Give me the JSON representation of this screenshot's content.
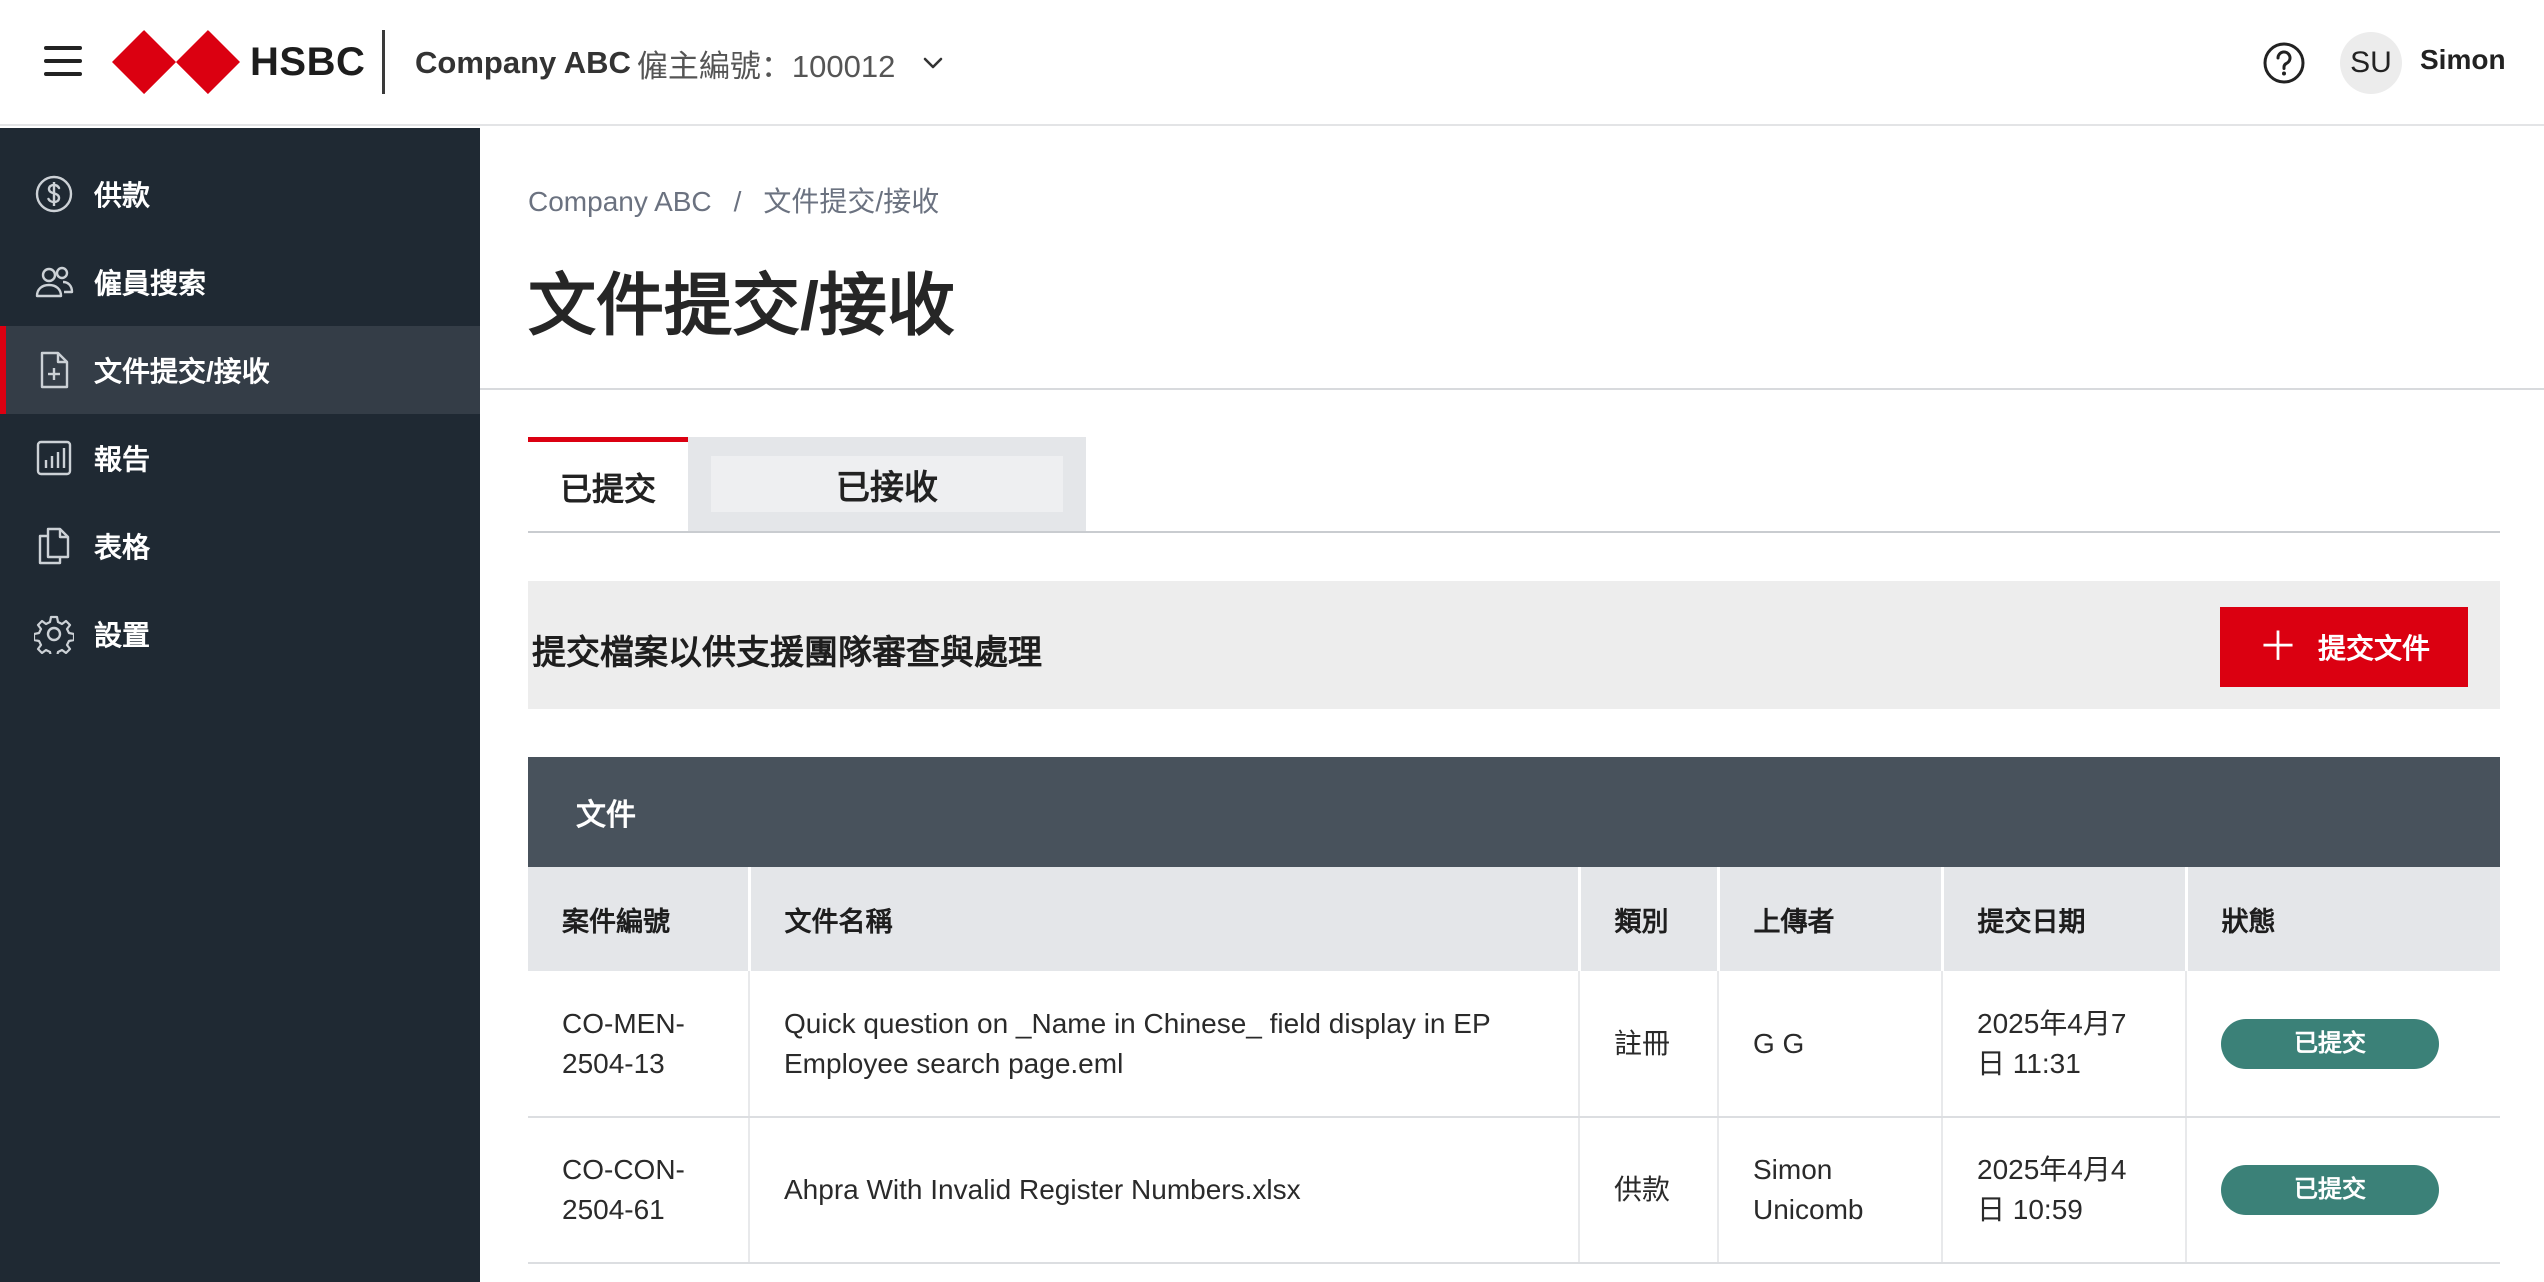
{
  "header": {
    "logo_text": "HSBC",
    "company_name": "Company ABC",
    "company_id_text": "僱主編號：100012",
    "user_initials": "SU",
    "user_name": "Simon"
  },
  "sidebar": {
    "items": [
      {
        "label": "供款",
        "icon": "dollar-circle-icon"
      },
      {
        "label": "僱員搜索",
        "icon": "users-icon"
      },
      {
        "label": "文件提交/接收",
        "icon": "file-plus-icon",
        "active": true
      },
      {
        "label": "報告",
        "icon": "bar-chart-icon"
      },
      {
        "label": "表格",
        "icon": "documents-icon"
      },
      {
        "label": "設置",
        "icon": "gear-icon"
      }
    ]
  },
  "breadcrumb": {
    "root": "Company ABC",
    "separator": "/",
    "current": "文件提交/接收"
  },
  "page": {
    "title": "文件提交/接收"
  },
  "tabs": {
    "submitted": "已提交",
    "received": "已接收"
  },
  "submit_bar": {
    "text": "提交檔案以供支援團隊審查與處理",
    "button_label": "提交文件"
  },
  "table": {
    "title": "文件",
    "headers": [
      "案件編號",
      "文件名稱",
      "類別",
      "上傳者",
      "提交日期",
      "狀態"
    ],
    "rows": [
      {
        "case_no_1": "CO-MEN-",
        "case_no_2": "2504-13",
        "file_name_1": "Quick question on _Name in Chinese_ field display in EP",
        "file_name_2": "Employee search page.eml",
        "category": "註冊",
        "uploader_1": "G G",
        "uploader_2": "",
        "date_1": "2025年4月7",
        "date_2": "日 11:31",
        "status": "已提交"
      },
      {
        "case_no_1": "CO-CON-",
        "case_no_2": "2504-61",
        "file_name_1": "Ahpra With Invalid Register Numbers.xlsx",
        "file_name_2": "",
        "category": "供款",
        "uploader_1": "Simon",
        "uploader_2": "Unicomb",
        "date_1": "2025年4月4",
        "date_2": "日 10:59",
        "status": "已提交"
      }
    ]
  },
  "colors": {
    "brand_red": "#db0011",
    "sidebar_bg": "#1f2933",
    "status_green": "#3b8178"
  }
}
